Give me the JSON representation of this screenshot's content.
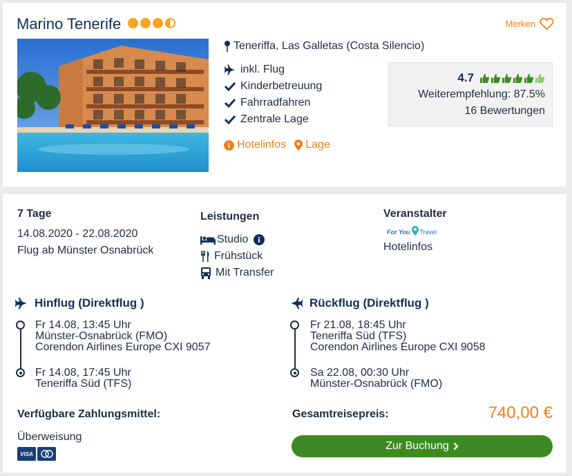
{
  "hotel": {
    "name": "Marino Tenerife",
    "location": "Teneriffa, Las Galletas (Costa Silencio)",
    "merken_label": "Merken",
    "features": [
      "inkl. Flug",
      "Kinderbetreuung",
      "Fahrradfahren",
      "Zentrale Lage"
    ],
    "links": {
      "hotelinfos": "Hotelinfos",
      "lage": "Lage"
    },
    "rating": {
      "score": "4.7",
      "recommendation": "Weiterempfehlung: 87.5%",
      "reviews": "16 Bewertungen"
    },
    "stars": 3.5
  },
  "offer": {
    "duration": "7 Tage",
    "dates": "14.08.2020 - 22.08.2020",
    "departure": "Flug ab Münster Osnabrück",
    "services": {
      "heading": "Leistungen",
      "items": [
        "Studio",
        "Frühstück",
        "Mit Transfer"
      ]
    },
    "operator": {
      "heading": "Veranstalter",
      "logo_text_1": "For You",
      "logo_text_2": "Travel",
      "link": "Hotelinfos"
    }
  },
  "outbound": {
    "heading": "Hinflug (Direktflug )",
    "dep_time": "Fr 14.08, 13:45 Uhr",
    "dep_airport": "Münster-Osnabrück (FMO)",
    "airline": "Corendon Airlines Europe CXI 9057",
    "arr_time": "Fr 14.08, 17:45 Uhr",
    "arr_airport": "Teneriffa Süd (TFS)"
  },
  "return": {
    "heading": "Rückflug (Direktflug )",
    "dep_time": "Fr 21.08, 18:45 Uhr",
    "dep_airport": "Teneriffa Süd (TFS)",
    "airline": "Corendon Airlines Europe CXI 9058",
    "arr_time": "Sa 22.08, 00:30 Uhr",
    "arr_airport": "Münster-Osnabrück (FMO)"
  },
  "payment": {
    "heading": "Verfügbare Zahlungsmittel:",
    "method": "Überweisung",
    "card_visa": "VISA"
  },
  "total": {
    "label": "Gesamtreisepreis:",
    "price": "740,00 €",
    "button": "Zur Buchung"
  },
  "colors": {
    "navy": "#0f2f5c",
    "orange": "#f07f1a",
    "green": "#3d8a22"
  }
}
